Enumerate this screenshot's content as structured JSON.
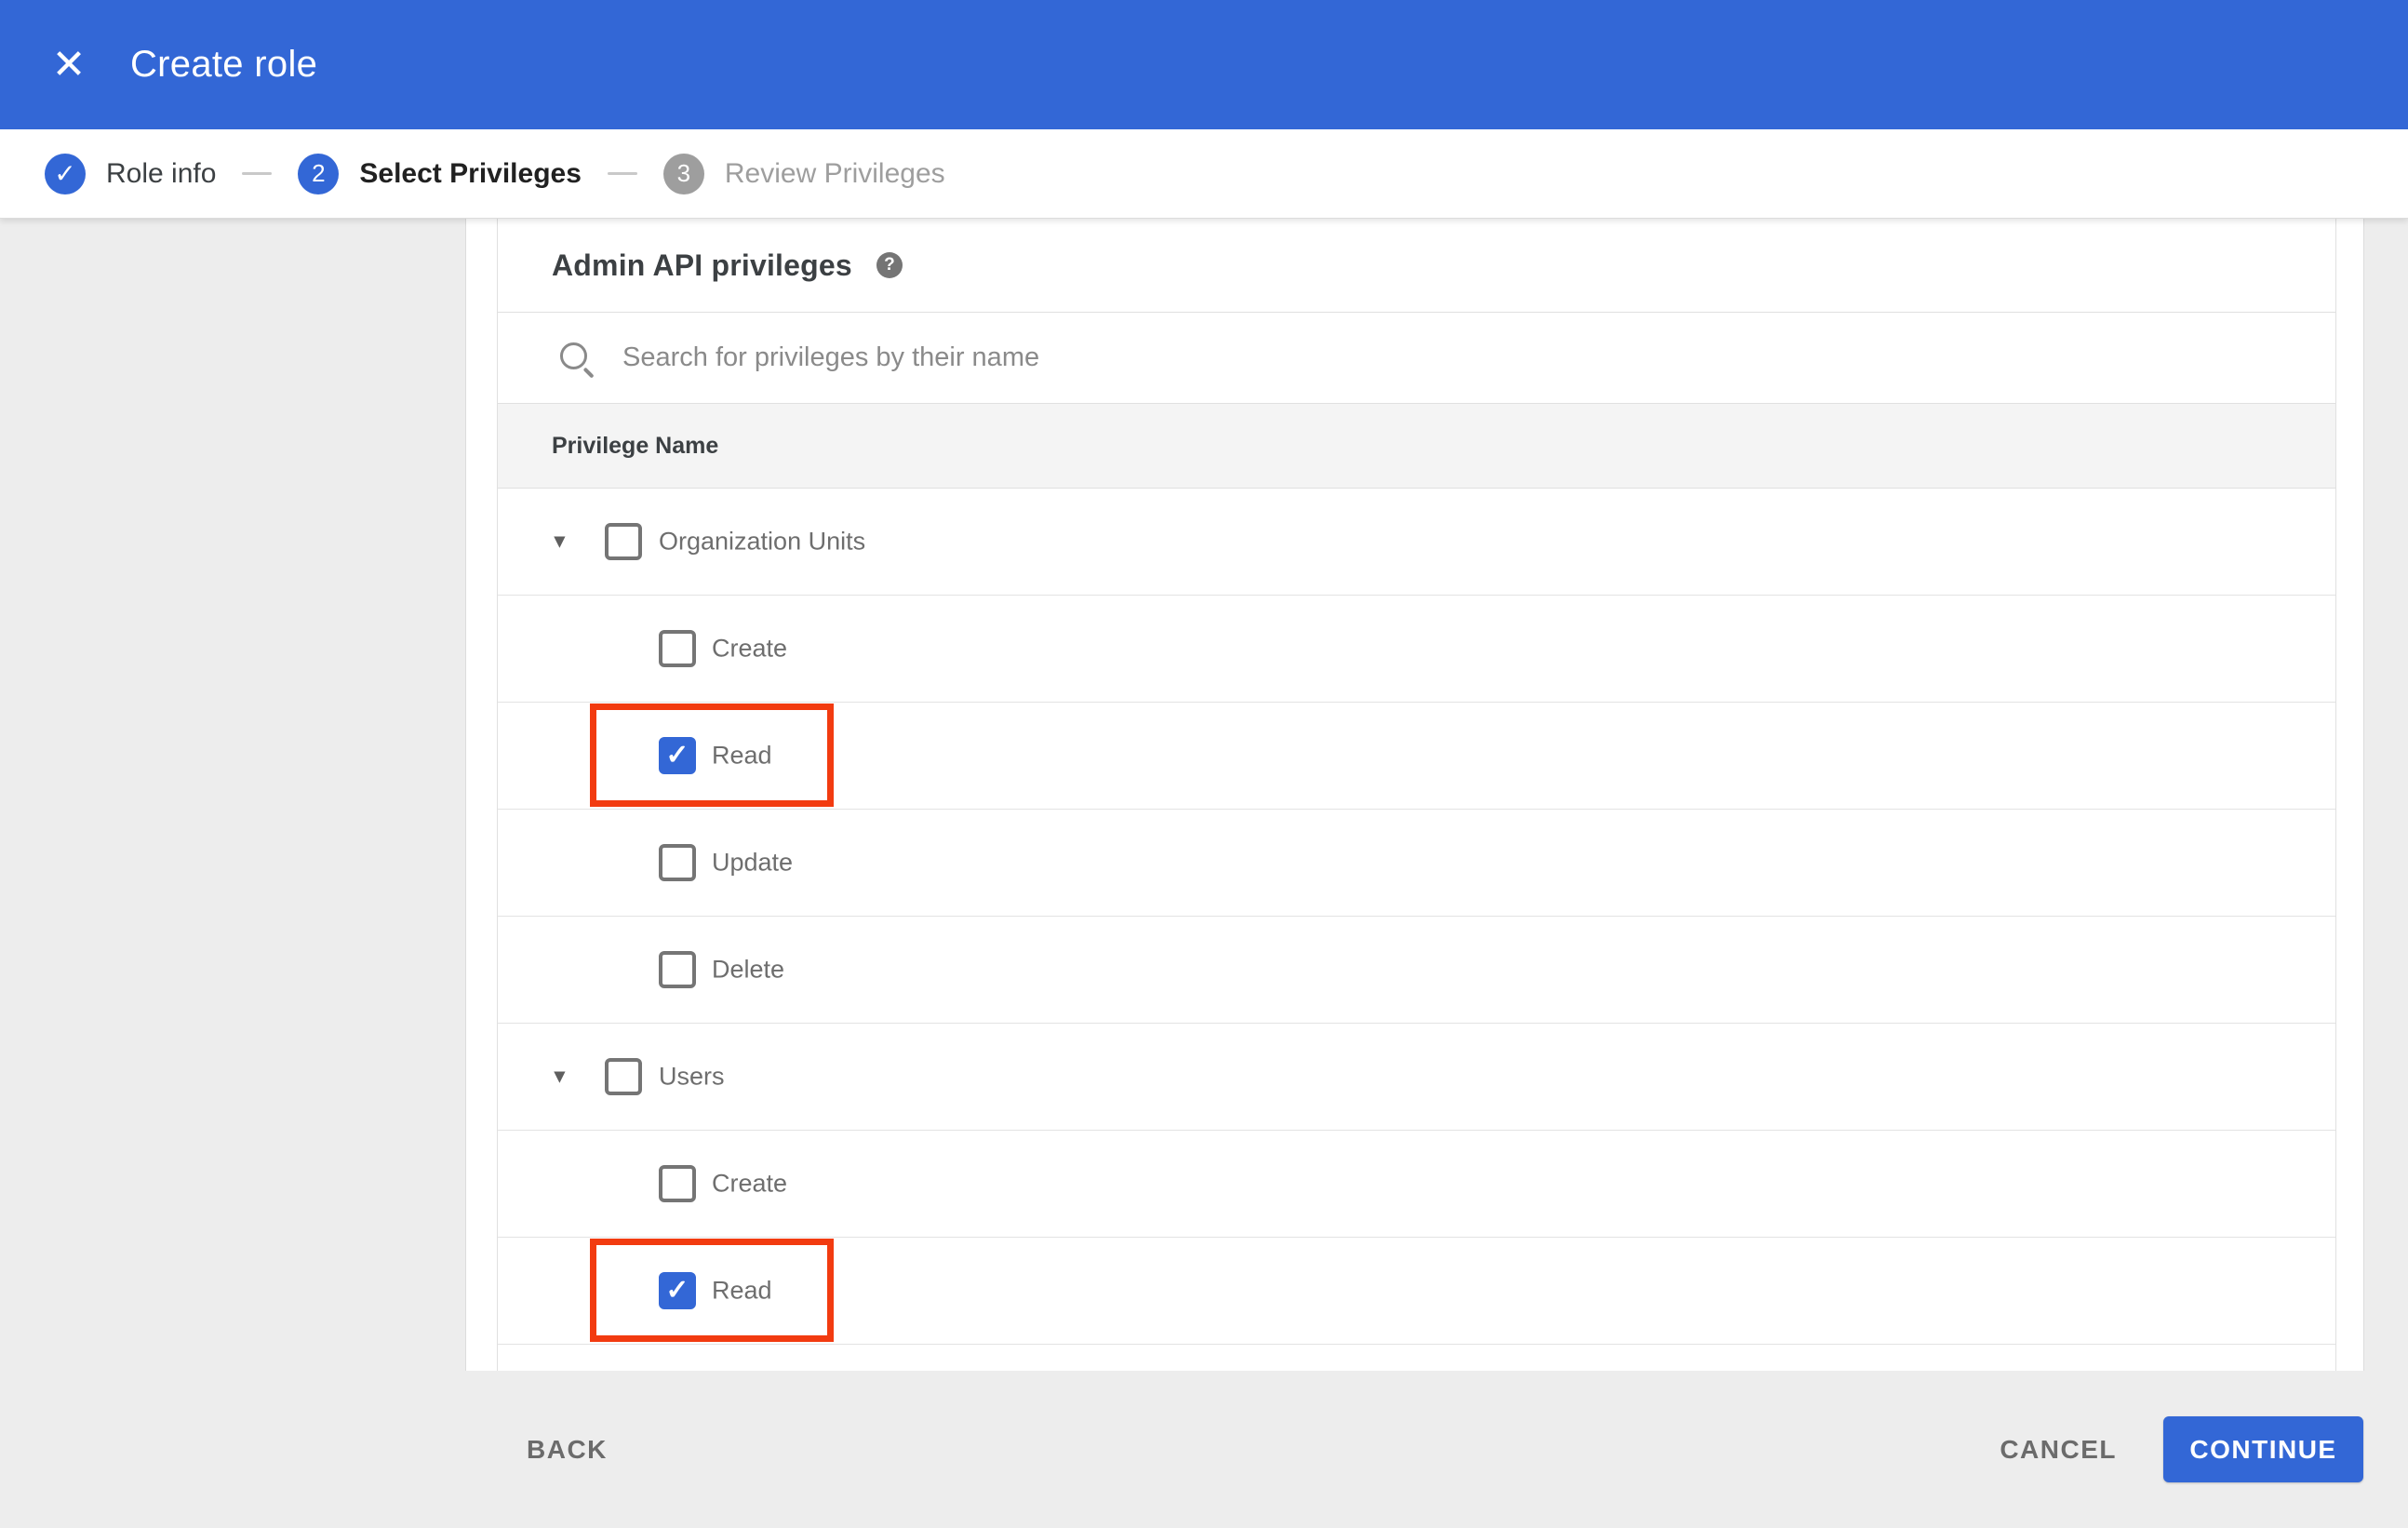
{
  "header": {
    "title": "Create role"
  },
  "icons": {
    "close": "✕",
    "check": "✓",
    "expand": "▼",
    "help": "?"
  },
  "stepper": {
    "steps": [
      {
        "label": "Role info",
        "state": "complete"
      },
      {
        "number": "2",
        "label": "Select Privileges",
        "state": "active"
      },
      {
        "number": "3",
        "label": "Review Privileges",
        "state": "upcoming"
      }
    ]
  },
  "panel": {
    "title": "Admin API privileges",
    "search_placeholder": "Search for privileges by their name",
    "search_value": "",
    "table_header": "Privilege Name",
    "groups": [
      {
        "label": "Organization Units",
        "checked": false,
        "expanded": true,
        "children": [
          {
            "label": "Create",
            "checked": false,
            "highlight": false
          },
          {
            "label": "Read",
            "checked": true,
            "highlight": true
          },
          {
            "label": "Update",
            "checked": false,
            "highlight": false
          },
          {
            "label": "Delete",
            "checked": false,
            "highlight": false
          }
        ]
      },
      {
        "label": "Users",
        "checked": false,
        "expanded": true,
        "children": [
          {
            "label": "Create",
            "checked": false,
            "highlight": false
          },
          {
            "label": "Read",
            "checked": true,
            "highlight": true
          }
        ]
      }
    ]
  },
  "footer": {
    "back": "BACK",
    "cancel": "CANCEL",
    "continue": "CONTINUE"
  },
  "colors": {
    "appbar": "#3367d6",
    "accent": "#3367d6",
    "highlight": "#f23b10",
    "step_inactive": "#9e9e9e"
  }
}
